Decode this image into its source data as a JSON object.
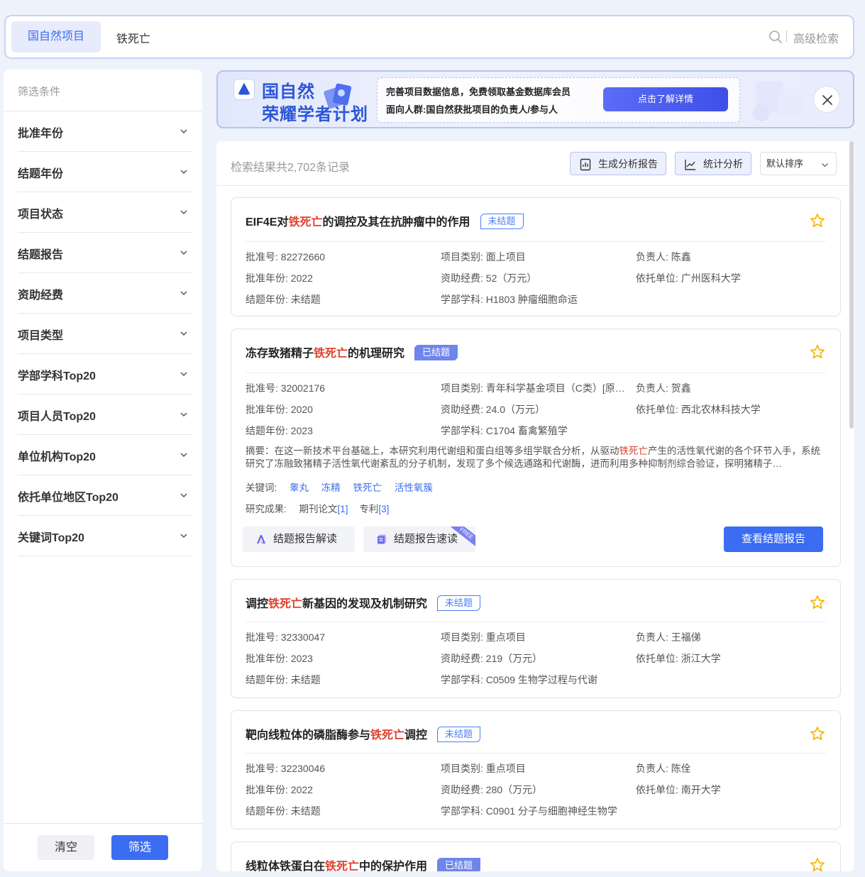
{
  "search": {
    "type_label": "国自然项目",
    "query": "铁死亡",
    "advanced_label": "高级检索",
    "search_icon": "search-icon"
  },
  "sidebar": {
    "title": "筛选条件",
    "items": [
      {
        "label": "批准年份"
      },
      {
        "label": "结题年份"
      },
      {
        "label": "项目状态"
      },
      {
        "label": "结题报告"
      },
      {
        "label": "资助经费"
      },
      {
        "label": "项目类型"
      },
      {
        "label": "学部学科Top20"
      },
      {
        "label": "项目人员Top20"
      },
      {
        "label": "单位机构Top20"
      },
      {
        "label": "依托单位地区Top20"
      },
      {
        "label": "关键词Top20"
      }
    ],
    "clear_label": "清空",
    "filter_label": "筛选"
  },
  "banner": {
    "title_line1": "国自然",
    "title_line2": "荣耀学者计划",
    "line1": "完善项目数据信息，免费领取基金数据库会员",
    "line2": "面向人群:国自然获批项目的负责人/参与人",
    "cta": "点击了解详情",
    "close_icon": "close-icon"
  },
  "results": {
    "count_text": "检索结果共2,702条记录",
    "report_btn": "生成分析报告",
    "stats_btn": "统计分析",
    "sort_label": "默认排序"
  },
  "cards": [
    {
      "title_pre": "EIF4E对",
      "title_hl": "铁死亡",
      "title_post": "的调控及其在抗肿瘤中的作用",
      "status": "未结题",
      "approval_no": "批准号: 82272660",
      "category": "项目类别: 面上项目",
      "leader": "负责人: 陈鑫",
      "approval_year": "批准年份: 2022",
      "funding": "资助经费: 52（万元）",
      "institution": "依托单位: 广州医科大学",
      "end_year": "结题年份: 未结题",
      "discipline": "学部学科: H1803 肿瘤细胞命运"
    },
    {
      "title_pre": "冻存致猪精子",
      "title_hl": "铁死亡",
      "title_post": "的机理研究",
      "status": "已结题",
      "approval_no": "批准号: 32002176",
      "category": "项目类别: 青年科学基金项目（C类）[原…",
      "leader": "负责人: 贺鑫",
      "approval_year": "批准年份: 2020",
      "funding": "资助经费: 24.0（万元）",
      "institution": "依托单位: 西北农林科技大学",
      "end_year": "结题年份: 2023",
      "discipline": "学部学科: C1704 畜禽繁殖学",
      "abstract_pre": "摘要：在这一新技术平台基础上，本研究利用代谢组和蛋白组等多组学联合分析，从驱动",
      "abstract_hl": "铁死亡",
      "abstract_post": "产生的活性氧代谢的各个环节入手，系统研究了冻融致猪精子活性氧代谢紊乱的分子机制，发现了多个候选通路和代谢酶，进而利用多种抑制剂综合验证，探明猪精子…",
      "keywords_label": "关键词:",
      "keywords": [
        "睾丸",
        "冻精",
        "铁死亡",
        "活性氧簇"
      ],
      "results_label": "研究成果:",
      "paper_label": "期刊论文",
      "paper_count": "[1]",
      "patent_label": "专利",
      "patent_count": "[3]",
      "interpret_btn": "结题报告解读",
      "quickread_btn": "结题报告速读",
      "quickread_badge": "FREE",
      "view_btn": "查看结题报告"
    },
    {
      "title_pre": "调控",
      "title_hl": "铁死亡",
      "title_post": "新基因的发现及机制研究",
      "status": "未结题",
      "approval_no": "批准号: 32330047",
      "category": "项目类别: 重点项目",
      "leader": "负责人: 王福俤",
      "approval_year": "批准年份: 2023",
      "funding": "资助经费: 219（万元）",
      "institution": "依托单位: 浙江大学",
      "end_year": "结题年份: 未结题",
      "discipline": "学部学科: C0509 生物学过程与代谢"
    },
    {
      "title_pre": "靶向线粒体的磷脂酶参与",
      "title_hl": "铁死亡",
      "title_post": "调控",
      "status": "未结题",
      "approval_no": "批准号: 32230046",
      "category": "项目类别: 重点项目",
      "leader": "负责人: 陈佺",
      "approval_year": "批准年份: 2022",
      "funding": "资助经费: 280（万元）",
      "institution": "依托单位: 南开大学",
      "end_year": "结题年份: 未结题",
      "discipline": "学部学科: C0901 分子与细胞神经生物学"
    },
    {
      "title_pre": "线粒体铁蛋白在",
      "title_hl": "铁死亡",
      "title_post": "中的保护作用",
      "status": "已结题"
    }
  ],
  "colors": {
    "accent": "#3b6df2",
    "highlight": "#e0402c",
    "star": "#f5b400",
    "done_badge": "#6f85ec"
  }
}
